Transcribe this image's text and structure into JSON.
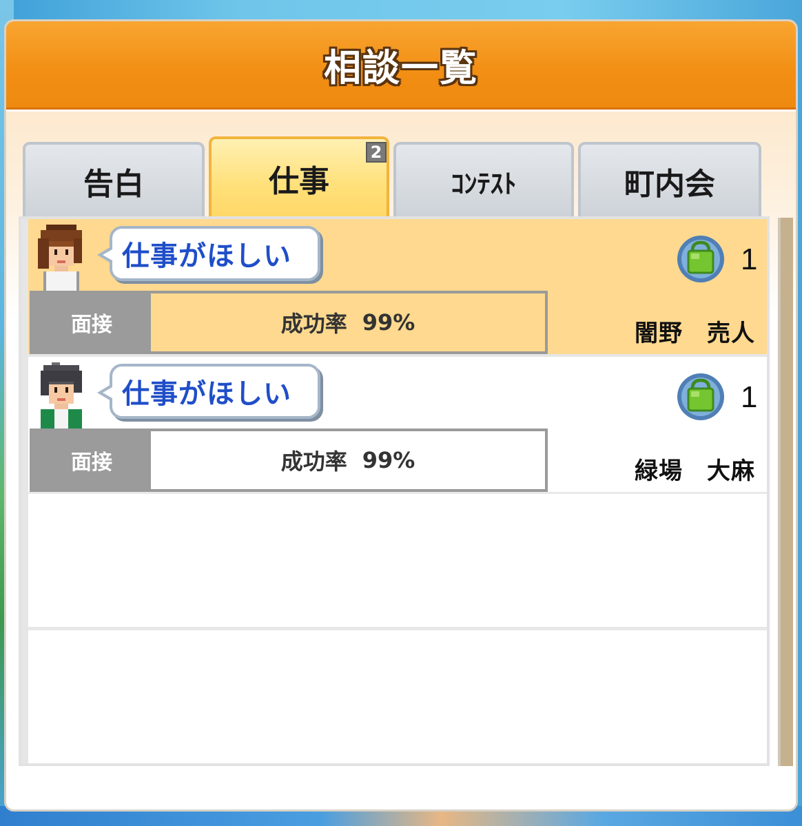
{
  "window": {
    "title": "相談一覧"
  },
  "tabs": [
    {
      "label": "告白",
      "active": false
    },
    {
      "label": "仕事",
      "active": true,
      "badge": "2"
    },
    {
      "label": "ｺﾝﾃｽﾄ",
      "active": false
    },
    {
      "label": "町内会",
      "active": false
    }
  ],
  "consultations": [
    {
      "request": "仕事がほしい",
      "count": "1",
      "stage": "面接",
      "success_label": "成功率",
      "success_value": "99%",
      "name": "闇野　売人",
      "selected": true,
      "avatar": "female-brown-hair-avatar"
    },
    {
      "request": "仕事がほしい",
      "count": "1",
      "stage": "面接",
      "success_label": "成功率",
      "success_value": "99%",
      "name": "緑場　大麻",
      "selected": false,
      "avatar": "male-gray-hair-avatar"
    }
  ],
  "icons": {
    "item": "green-bag-icon"
  },
  "colors": {
    "title_bar": "#f28e13",
    "active_tab": "#ffe079",
    "selected_row": "#ffd98f",
    "request_text": "#1f4ec8"
  }
}
